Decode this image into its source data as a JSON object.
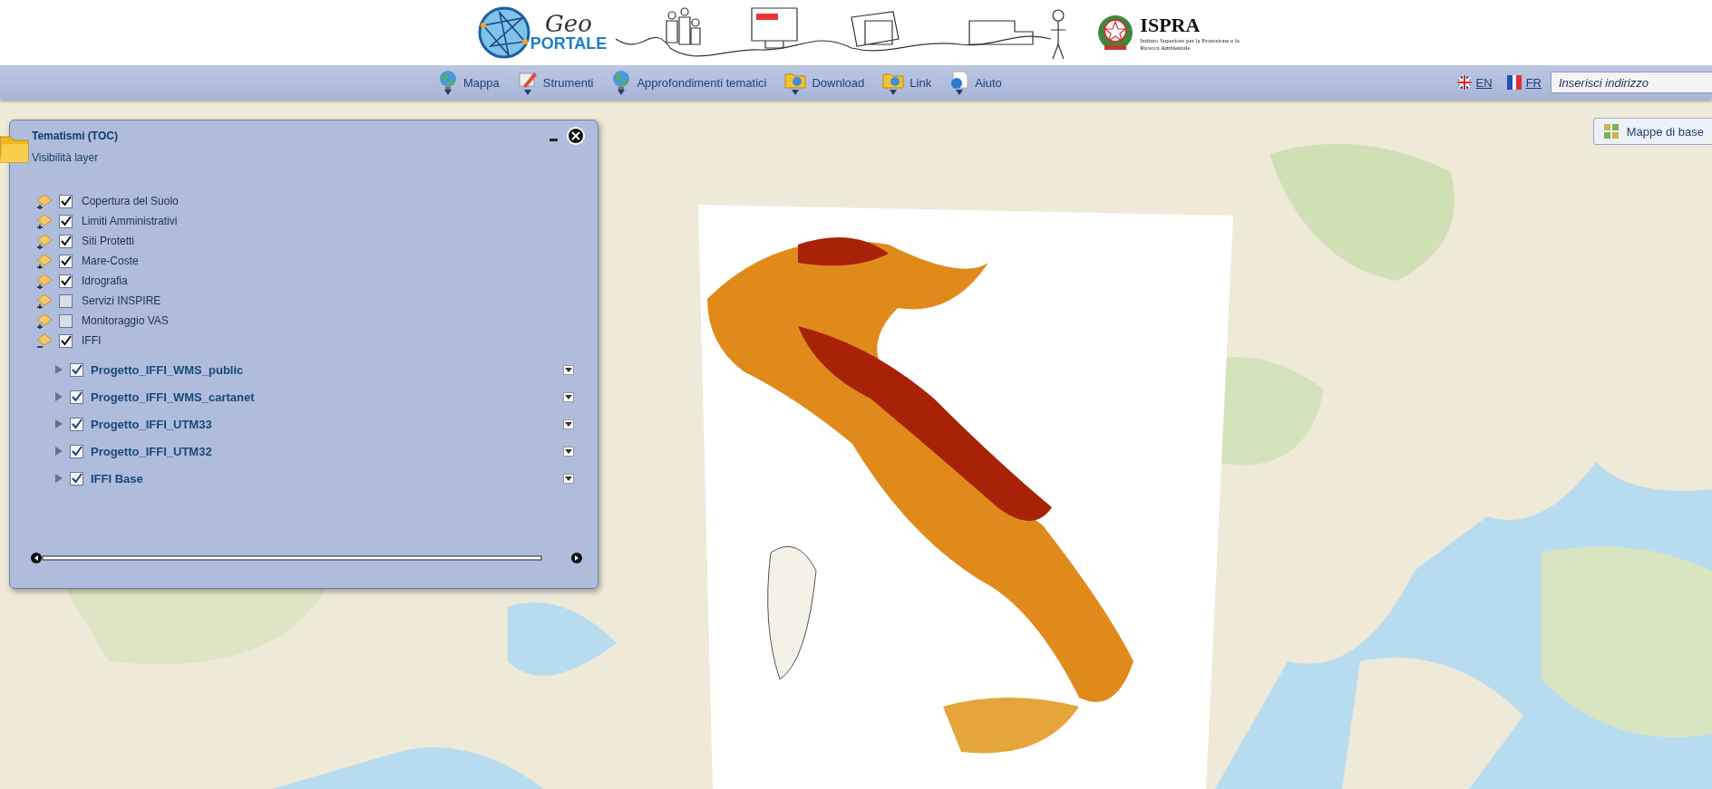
{
  "header": {
    "logo_word": "Geo",
    "logo_text": "PORTALE",
    "agency": "ISPRA",
    "agency_subtitle": "Istituto Superiore per la Protezione e la Ricerca Ambientale"
  },
  "menu": [
    {
      "label": "Mappa",
      "kind": "globe"
    },
    {
      "label": "Strumenti",
      "kind": "tools"
    },
    {
      "label": "Approfondimenti tematici",
      "kind": "globe"
    },
    {
      "label": "Download",
      "kind": "folder"
    },
    {
      "label": "Link",
      "kind": "folder"
    },
    {
      "label": "Aiuto",
      "kind": "help"
    }
  ],
  "languages": [
    {
      "code": "EN",
      "kind": "uk"
    },
    {
      "code": "FR",
      "kind": "fr"
    }
  ],
  "search": {
    "placeholder": "Inserisci indirizzo"
  },
  "basemap_button": "Mappe di base",
  "toc": {
    "title": "Tematismi (TOC)",
    "subtitle": "Visibilità layer",
    "layers": [
      {
        "label": "Copertura del Suolo",
        "checked": true,
        "expanded": false
      },
      {
        "label": "Limiti Amministrativi",
        "checked": true,
        "expanded": false
      },
      {
        "label": "Siti Protetti",
        "checked": true,
        "expanded": false
      },
      {
        "label": "Mare-Coste",
        "checked": true,
        "expanded": false
      },
      {
        "label": "Idrografia",
        "checked": true,
        "expanded": false
      },
      {
        "label": "Servizi INSPIRE",
        "checked": false,
        "expanded": false
      },
      {
        "label": "Monitoraggio VAS",
        "checked": false,
        "expanded": false
      },
      {
        "label": "IFFI",
        "checked": true,
        "expanded": true,
        "children": [
          {
            "label": "Progetto_IFFI_WMS_public",
            "checked": true
          },
          {
            "label": "Progetto_IFFI_WMS_cartanet",
            "checked": true
          },
          {
            "label": "Progetto_IFFI_UTM33",
            "checked": true
          },
          {
            "label": "Progetto_IFFI_UTM32",
            "checked": true
          },
          {
            "label": "IFFI Base",
            "checked": true
          }
        ]
      }
    ]
  }
}
